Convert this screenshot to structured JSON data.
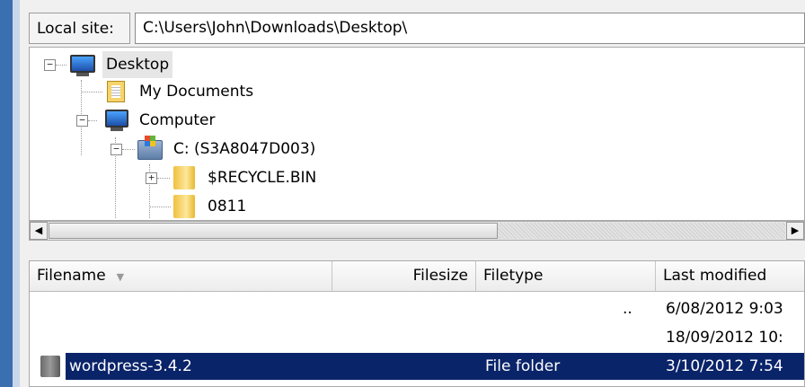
{
  "local_site": {
    "label": "Local site:",
    "path": "C:\\Users\\John\\Downloads\\Desktop\\"
  },
  "tree": {
    "nodes": [
      {
        "label": "Desktop",
        "icon": "monitor-icon",
        "expander": "minus"
      },
      {
        "label": "My Documents",
        "icon": "documents-icon",
        "expander": ""
      },
      {
        "label": "Computer",
        "icon": "computer-icon",
        "expander": "minus"
      },
      {
        "label": "C: (S3A8047D003)",
        "icon": "drive-icon",
        "expander": "minus"
      },
      {
        "label": "$RECYCLE.BIN",
        "icon": "folder-icon",
        "expander": "plus"
      },
      {
        "label": "0811",
        "icon": "folder-icon",
        "expander": ""
      }
    ]
  },
  "scrollbar": {
    "left_arrow": "◀",
    "right_arrow": "▶"
  },
  "file_list": {
    "columns": [
      "Filename",
      "Filesize",
      "Filetype",
      "Last modified"
    ],
    "rows": [
      {
        "filename": "",
        "filesize": "",
        "filetype": "..",
        "last_modified": "6/08/2012 9:03"
      },
      {
        "filename": "",
        "filesize": "",
        "filetype": "",
        "last_modified": "18/09/2012 10:"
      },
      {
        "filename": "wordpress-3.4.2",
        "filesize": "",
        "filetype": "File folder",
        "last_modified": "3/10/2012 7:54",
        "selected": true
      }
    ]
  },
  "colors": {
    "selection": "#0a246a",
    "left_strip": "#3a6fb0"
  }
}
